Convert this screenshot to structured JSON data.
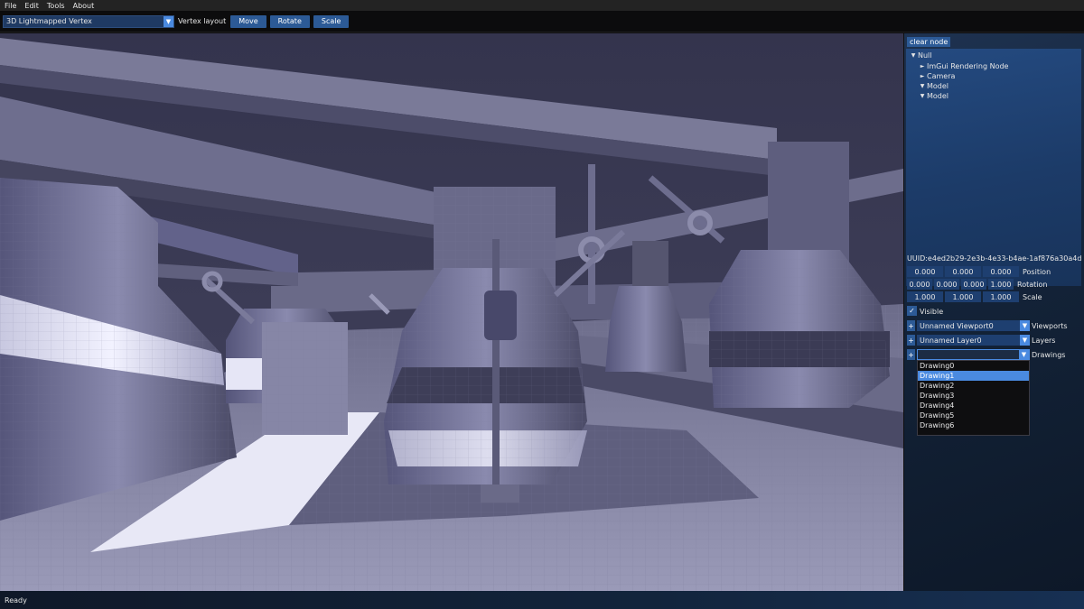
{
  "menu": [
    "File",
    "Edit",
    "Tools",
    "About"
  ],
  "toolbar": {
    "layout_value": "3D Lightmapped Vertex",
    "layout_label": "Vertex layout",
    "buttons": [
      "Move",
      "Rotate",
      "Scale"
    ]
  },
  "panel": {
    "clear_node": "clear node",
    "tree": [
      {
        "label": "Null",
        "expanded": true,
        "depth": 0
      },
      {
        "label": "ImGui Rendering Node",
        "expanded": false,
        "depth": 1
      },
      {
        "label": "Camera",
        "expanded": false,
        "depth": 1
      },
      {
        "label": "Model",
        "expanded": true,
        "depth": 1
      },
      {
        "label": "Model",
        "expanded": true,
        "depth": 1
      }
    ],
    "uuid": "UUID:e4ed2b29-2e3b-4e33-b4ae-1af876a30a4d",
    "position": {
      "values": [
        "0.000",
        "0.000",
        "0.000"
      ],
      "label": "Position"
    },
    "rotation": {
      "values": [
        "0.000",
        "0.000",
        "0.000",
        "1.000"
      ],
      "label": "Rotation"
    },
    "scale": {
      "values": [
        "1.000",
        "1.000",
        "1.000"
      ],
      "label": "Scale"
    },
    "visible_label": "Visible",
    "visible_checked": true,
    "viewports": {
      "value": "Unnamed Viewport0",
      "label": "Viewports"
    },
    "layers": {
      "value": "Unnamed Layer0",
      "label": "Layers"
    },
    "drawings": {
      "value": "",
      "label": "Drawings"
    },
    "drawing_options": [
      "Drawing0",
      "Drawing1",
      "Drawing2",
      "Drawing3",
      "Drawing4",
      "Drawing5",
      "Drawing6"
    ],
    "drawing_selected_index": 1
  },
  "status": {
    "text": "Ready"
  },
  "colors": {
    "accent": "#4a8ae0",
    "button": "#2c5a96",
    "field": "#1e3f70"
  }
}
